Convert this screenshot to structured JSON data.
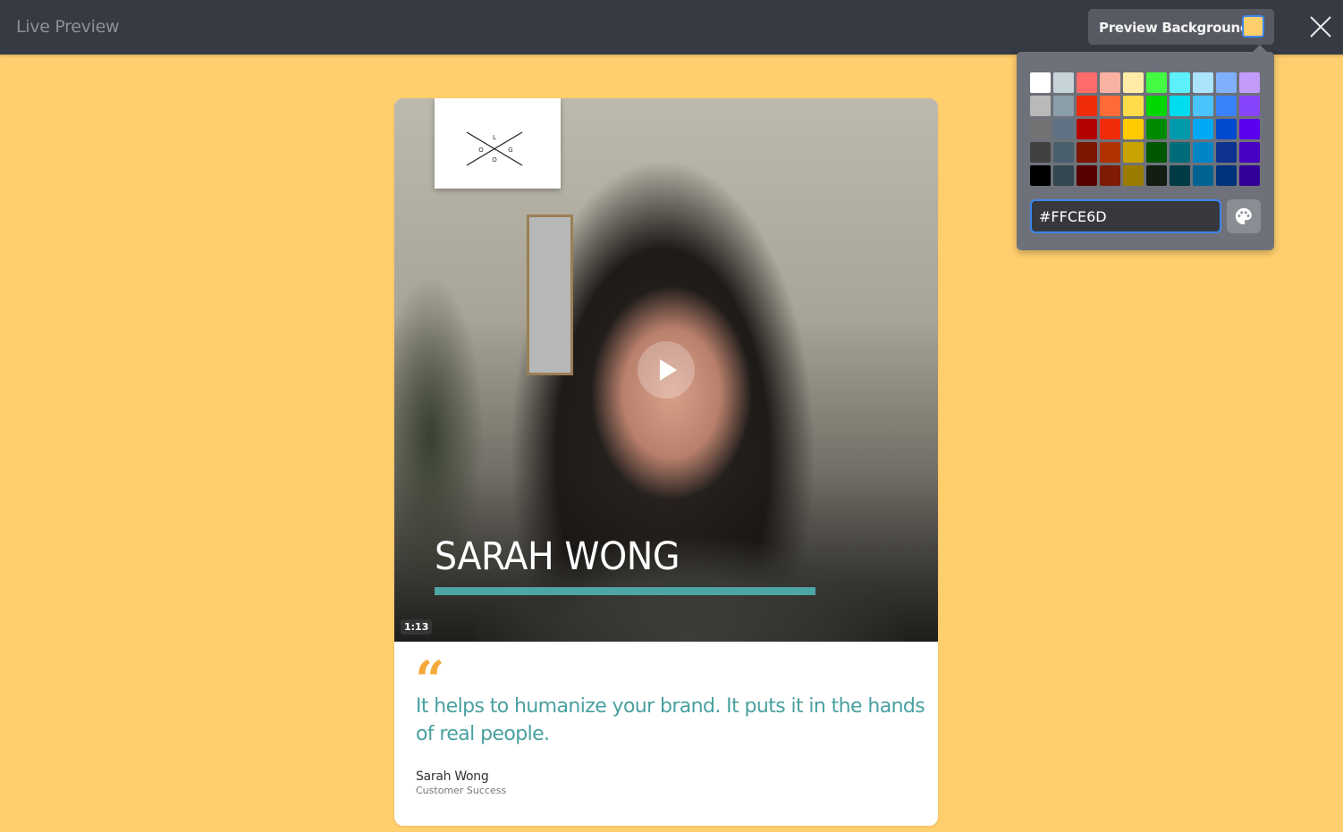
{
  "header": {
    "title": "Live Preview",
    "preview_background_label": "Preview Background",
    "preview_background_color": "#FFCE6D"
  },
  "color_picker": {
    "hex_value": "#FFCE6D",
    "swatches": [
      [
        "#FFFFFF",
        "#C6D3D9",
        "#FF6B6B",
        "#F9B1A2",
        "#FFECA6",
        "#42FB42",
        "#5CF0FB",
        "#ABE3FB",
        "#80B0FB",
        "#C39BFB"
      ],
      [
        "#B9B9B9",
        "#8B9DA8",
        "#F22B0B",
        "#FF6B38",
        "#FFDC4A",
        "#00D600",
        "#00DCEF",
        "#4AC4FB",
        "#3A82F9",
        "#8645FB"
      ],
      [
        "#737373",
        "#5F7385",
        "#B30000",
        "#F22B0B",
        "#FFCB00",
        "#008A00",
        "#009AAC",
        "#00A9F5",
        "#004AD0",
        "#5C00F0"
      ],
      [
        "#414141",
        "#4A5F6D",
        "#7D1600",
        "#B13200",
        "#C9A300",
        "#005700",
        "#006C79",
        "#0086C6",
        "#0D3290",
        "#4800C4"
      ],
      [
        "#000000",
        "#344650",
        "#560100",
        "#7F1A04",
        "#9A7D00",
        "#121E12",
        "#003A45",
        "#006392",
        "#00337C",
        "#330097"
      ]
    ],
    "palette_button_icon": "palette-icon"
  },
  "card": {
    "logo_letters": [
      "L",
      "O",
      "G",
      "O"
    ],
    "video_name": "SARAH WONG",
    "duration": "1:13",
    "name_bar_color": "#4EA5A5",
    "quote_mark": "“",
    "quote": " It helps to humanize your brand. It puts it in the hands of real people.",
    "author_name": "Sarah Wong",
    "author_role": "Customer Success"
  }
}
